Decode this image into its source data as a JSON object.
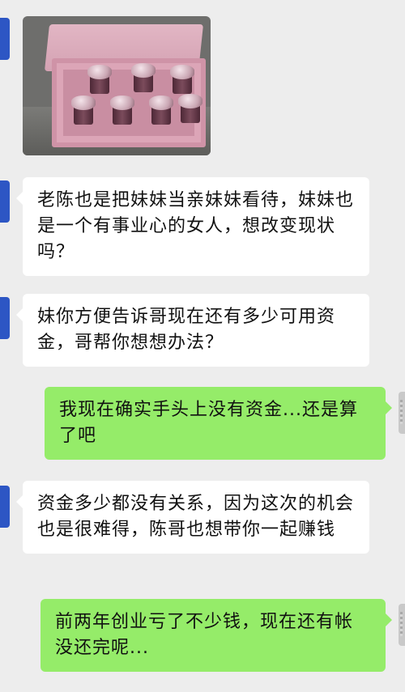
{
  "chat": {
    "messages": [
      {
        "side": "left",
        "type": "image",
        "image": {
          "icon": "pink-gift-box-with-bottles-photo"
        }
      },
      {
        "side": "left",
        "type": "text",
        "text": "老陈也是把妹妹当亲妹妹看待，妹妹也是一个有事业心的女人，想改变现状吗？"
      },
      {
        "side": "left",
        "type": "text",
        "text": "妹你方便告诉哥现在还有多少可用资金，哥帮你想想办法？"
      },
      {
        "side": "right",
        "type": "text",
        "text": "我现在确实手头上没有资金...还是算了吧"
      },
      {
        "side": "left",
        "type": "text",
        "text": "资金多少都没有关系，因为这次的机会也是很难得，陈哥也想带你一起赚钱"
      },
      {
        "side": "right",
        "type": "text",
        "text": "前两年创业亏了不少钱，现在还有帐没还完呢..."
      }
    ]
  },
  "colors": {
    "background": "#ededed",
    "incoming_bubble": "#ffffff",
    "outgoing_bubble": "#95ec69",
    "contact_avatar": "#2d56c4"
  }
}
